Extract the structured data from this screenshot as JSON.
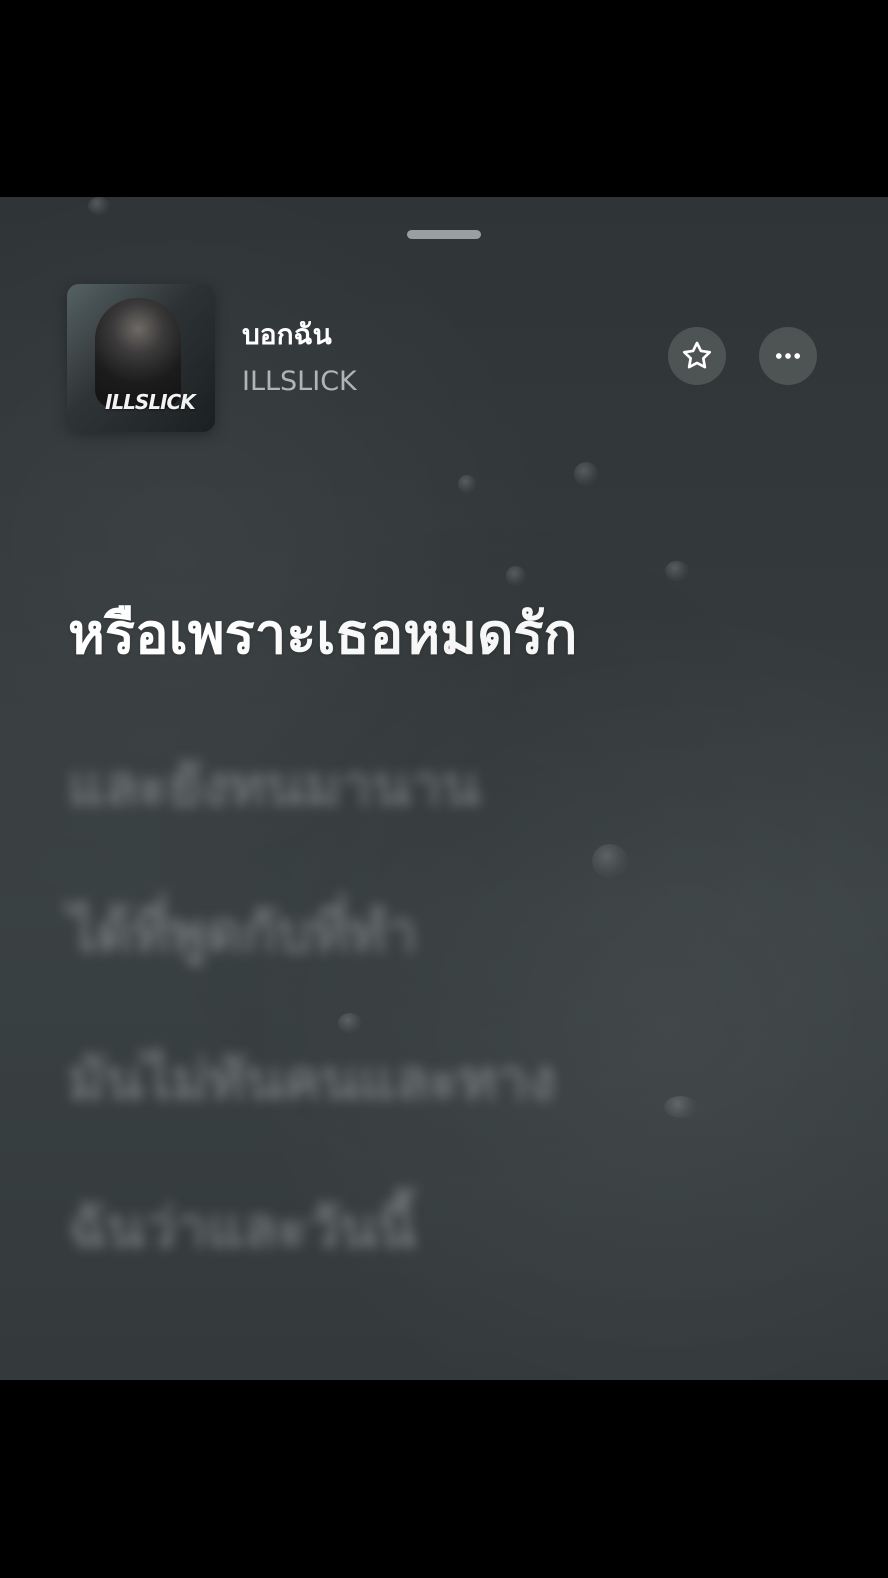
{
  "track": {
    "title": "บอกฉัน",
    "artist": "ILLSLICK",
    "artwork_text": "ILLSLICK"
  },
  "controls": {
    "favorite_icon": "star-icon",
    "more_icon": "more-horizontal-icon"
  },
  "lyrics": {
    "current": "หรือเพราะเธอหมดรัก",
    "upcoming": [
      "และยังทนมานาน",
      "ได้ที่พูดกับที่ทำ",
      "มันไม่ทันคนและทาง",
      "ฉันว่าและวันนี้"
    ]
  },
  "colors": {
    "background": "#343a3c",
    "accent": "#ffffff"
  }
}
